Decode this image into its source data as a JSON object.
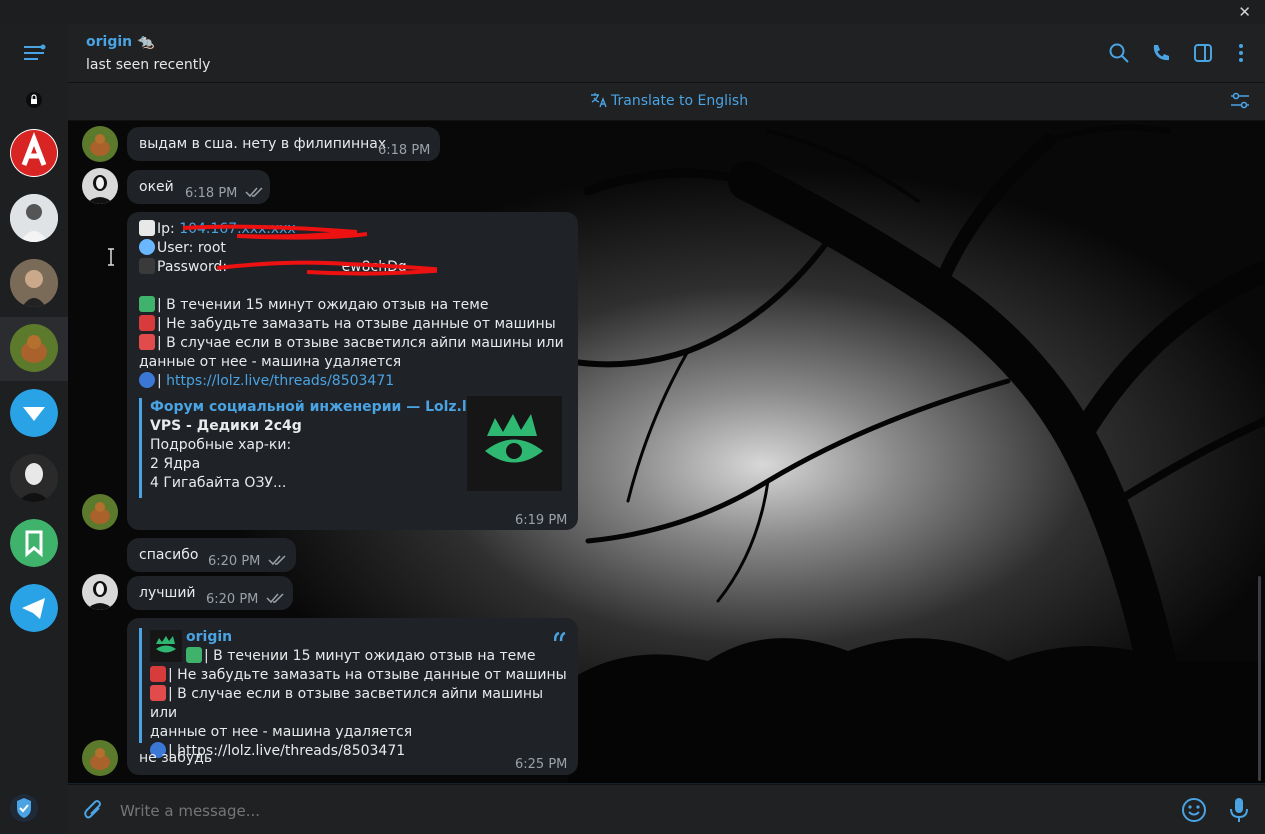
{
  "window": {
    "close_glyph": "✕"
  },
  "header": {
    "name": "origin 🐀",
    "status": "last seen recently",
    "icons": [
      "search-icon",
      "phone-icon",
      "sidebar-toggle-icon",
      "more-vertical-icon"
    ]
  },
  "translate": {
    "label": "Translate to English"
  },
  "colors": {
    "accent": "#4aa3e3",
    "bubble": "#1f2226",
    "sidebar": "#1d1f21",
    "header": "#1f2123"
  },
  "messages": {
    "m1": {
      "text": "выдам в сша. нету в филипиннах",
      "time": "6:18 PM"
    },
    "m2": {
      "text": "окей",
      "time": "6:18 PM"
    },
    "m3": {
      "ip_prefix": "Ip: ",
      "ip_value": "104.167.xxx.xxx",
      "user": "User: root",
      "password_prefix": "Password: ",
      "password_tail": "ew8chDg",
      "line1": "| В течении 15 минут ожидаю отзыв на теме",
      "line2": "| Не забудьте замазать на отзыве данные от машины",
      "line3a": "| В случае если в отзыве засветился айпи машины или",
      "line3b": "данные от нее - машина удаляется",
      "link": "https://lolz.live/threads/8503471",
      "preview_site": "Форум социальной инженерии —  Lolz.liv...",
      "preview_title": "VPS - Дедики 2c4g",
      "preview_l1": "Подробные хар-ки:",
      "preview_l2": "2 Ядра",
      "preview_l3": "4 Гигабайта ОЗУ...",
      "time": "6:19 PM"
    },
    "m4": {
      "text": "спасибо",
      "time": "6:20 PM"
    },
    "m5": {
      "text": "лучший",
      "time": "6:20 PM"
    },
    "m6": {
      "quote_author": "origin",
      "q1": "| В течении 15 минут ожидаю отзыв на теме",
      "q2": "| Не забудьте замазать на отзыве данные от машины",
      "q3a": "| В случае если в отзыве засветился айпи машины или",
      "q3b": "данные от нее - машина удаляется",
      "q4": "| https://lolz.live/threads/8503471",
      "text": "не забудь",
      "time": "6:25 PM"
    }
  },
  "composer": {
    "placeholder": "Write a message..."
  }
}
